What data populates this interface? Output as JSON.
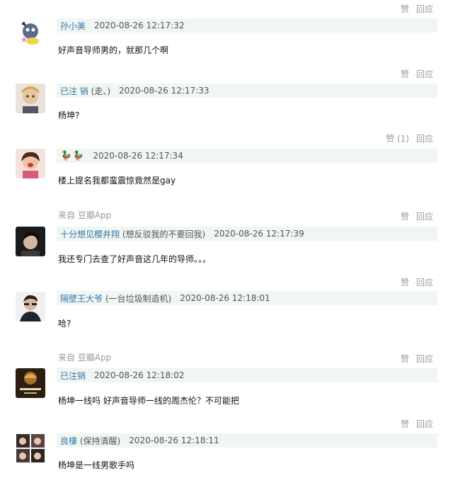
{
  "comments": [
    {
      "actions": {
        "like": "赞",
        "reply": "回应"
      },
      "username": "孙小美",
      "note": "",
      "time": "2020-08-26 12:17:32",
      "text": "好声音导师男的，就那几个啊",
      "source": ""
    },
    {
      "actions": {
        "like": "赞",
        "reply": "回应"
      },
      "username": "已注 销",
      "note": "(走、)",
      "time": "2020-08-26 12:17:33",
      "text": "杨坤?",
      "source": ""
    },
    {
      "actions": {
        "like": "赞 (1)",
        "reply": "回应"
      },
      "username": "🦆🦆",
      "note": "",
      "time": "2020-08-26 12:17:34",
      "text": "楼上提名我都蛮震惊竟然是gay",
      "source": ""
    },
    {
      "actions": {
        "like": "赞",
        "reply": "回应"
      },
      "username": "十分想见樱井翔",
      "note": "(想反驳我的不要回我)",
      "time": "2020-08-26 12:17:39",
      "text": "我还专门去查了好声音这几年的导师。。。",
      "source": "来自 豆瓣App"
    },
    {
      "actions": {
        "like": "赞",
        "reply": "回应"
      },
      "username": "隔壁王大爷",
      "note": "(一台垃圾制造机)",
      "time": "2020-08-26 12:18:01",
      "text": "哈?",
      "source": ""
    },
    {
      "actions": {
        "like": "赞",
        "reply": "回应"
      },
      "username": "已注销",
      "note": "",
      "time": "2020-08-26 12:18:02",
      "text": "杨坤一线吗 好声音导师一线的周杰伦？不可能把",
      "source": "来自 豆瓣App"
    },
    {
      "actions": {
        "like": "赞",
        "reply": "回应"
      },
      "username": "良棲",
      "note": "(保持清醒)",
      "time": "2020-08-26 12:18:11",
      "text": "杨坤是一线男歌手吗",
      "source": ""
    }
  ]
}
